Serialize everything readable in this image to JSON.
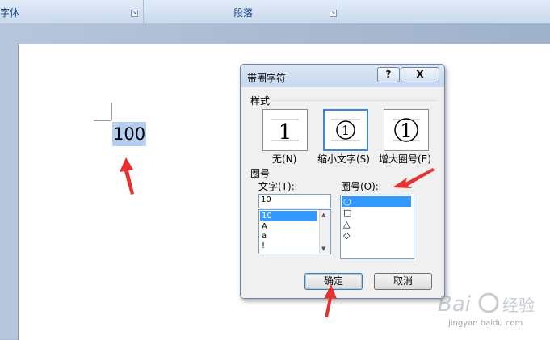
{
  "ribbon": {
    "group_font": "字体",
    "group_paragraph": "段落",
    "launcher_glyph": "↘"
  },
  "document": {
    "selected_text": "100"
  },
  "dialog": {
    "title": "带圈字符",
    "help_label": "?",
    "close_label": "X",
    "style_section_label": "样式",
    "style_options": [
      {
        "label": "无(N)",
        "glyph": "1"
      },
      {
        "label": "缩小文字(S)",
        "glyph": "1"
      },
      {
        "label": "增大圈号(E)",
        "glyph": "1"
      }
    ],
    "selected_style_index": 1,
    "enclosure_section_label": "圈号",
    "text_label": "文字(T):",
    "text_value": "10",
    "text_list": [
      "10",
      "A",
      "a",
      "!"
    ],
    "enclosure_label": "圈号(O):",
    "enclosure_list": [
      "○",
      "□",
      "△",
      "◇"
    ],
    "ok_label": "确定",
    "cancel_label": "取消"
  },
  "colors": {
    "arrow": "#e8312f",
    "selection": "#3399ff",
    "highlight_text": "#b6cff0"
  },
  "watermark": {
    "brand": "Bai 经验",
    "url": "jingyan.baidu.com"
  }
}
